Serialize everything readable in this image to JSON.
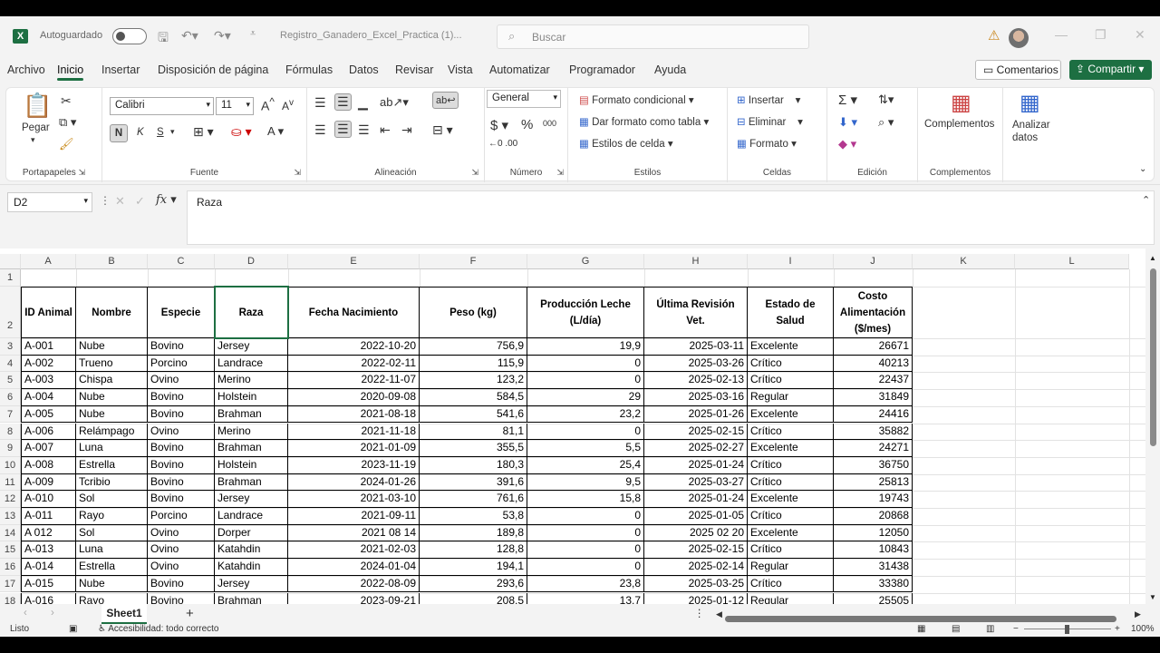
{
  "titlebar": {
    "autosave_label": "Autoguardado",
    "doc_title": "Registro_Ganadero_Excel_Practica (1)...",
    "search_placeholder": "Buscar"
  },
  "menu": {
    "tabs": [
      "Archivo",
      "Inicio",
      "Insertar",
      "Disposición de página",
      "Fórmulas",
      "Datos",
      "Revisar",
      "Vista",
      "Automatizar",
      "Programador",
      "Ayuda"
    ],
    "active": "Inicio",
    "comments_label": "Comentarios",
    "share_label": "Compartir"
  },
  "ribbon": {
    "portapapeles": {
      "label": "Portapapeles",
      "paste": "Pegar"
    },
    "fuente": {
      "label": "Fuente",
      "font_name": "Calibri",
      "font_size": "11",
      "bold": "N",
      "italic": "K",
      "underline": "S"
    },
    "alineacion": {
      "label": "Alineación"
    },
    "numero": {
      "label": "Número",
      "format": "General"
    },
    "estilos": {
      "label": "Estilos",
      "cond_format": "Formato condicional",
      "table_format": "Dar formato como tabla",
      "cell_styles": "Estilos de celda"
    },
    "celdas": {
      "label": "Celdas",
      "insert": "Insertar",
      "delete": "Eliminar",
      "format": "Formato"
    },
    "edicion": {
      "label": "Edición"
    },
    "complementos": {
      "label": "Complementos",
      "addins": "Complementos",
      "analyze": "Analizar datos"
    }
  },
  "formula_bar": {
    "name_box": "D2",
    "content": "Raza"
  },
  "columns": [
    "A",
    "B",
    "C",
    "D",
    "E",
    "F",
    "G",
    "H",
    "I",
    "J",
    "K",
    "L"
  ],
  "headers": [
    "ID Animal",
    "Nombre",
    "Especie",
    "Raza",
    "Fecha Nacimiento",
    "Peso (kg)",
    "Producción Leche (L/día)",
    "Última Revisión Vet.",
    "Estado de Salud",
    "Costo Alimentación ($/mes)"
  ],
  "rows": [
    [
      "A-001",
      "Nube",
      "Bovino",
      "Jersey",
      "2022-10-20",
      "756,9",
      "19,9",
      "2025-03-11",
      "Excelente",
      "26671"
    ],
    [
      "A-002",
      "Trueno",
      "Porcino",
      "Landrace",
      "2022-02-11",
      "115,9",
      "0",
      "2025-03-26",
      "Crítico",
      "40213"
    ],
    [
      "A-003",
      "Chispa",
      "Ovino",
      "Merino",
      "2022-11-07",
      "123,2",
      "0",
      "2025-02-13",
      "Crítico",
      "22437"
    ],
    [
      "A-004",
      "Nube",
      "Bovino",
      "Holstein",
      "2020-09-08",
      "584,5",
      "29",
      "2025-03-16",
      "Regular",
      "31849"
    ],
    [
      "A-005",
      "Nube",
      "Bovino",
      "Brahman",
      "2021-08-18",
      "541,6",
      "23,2",
      "2025-01-26",
      "Excelente",
      "24416"
    ],
    [
      "A-006",
      "Relámpago",
      "Ovino",
      "Merino",
      "2021-11-18",
      "81,1",
      "0",
      "2025-02-15",
      "Crítico",
      "35882"
    ],
    [
      "A-007",
      "Luna",
      "Bovino",
      "Brahman",
      "2021-01-09",
      "355,5",
      "5,5",
      "2025-02-27",
      "Excelente",
      "24271"
    ],
    [
      "A-008",
      "Estrella",
      "Bovino",
      "Holstein",
      "2023-11-19",
      "180,3",
      "25,4",
      "2025-01-24",
      "Crítico",
      "36750"
    ],
    [
      "A-009",
      "Tcribio",
      "Bovino",
      "Brahman",
      "2024-01-26",
      "391,6",
      "9,5",
      "2025-03-27",
      "Crítico",
      "25813"
    ],
    [
      "A-010",
      "Sol",
      "Bovino",
      "Jersey",
      "2021-03-10",
      "761,6",
      "15,8",
      "2025-01-24",
      "Excelente",
      "19743"
    ],
    [
      "A-011",
      "Rayo",
      "Porcino",
      "Landrace",
      "2021-09-11",
      "53,8",
      "0",
      "2025-01-05",
      "Crítico",
      "20868"
    ],
    [
      "A 012",
      "Sol",
      "Ovino",
      "Dorper",
      "2021 08 14",
      "189,8",
      "0",
      "2025 02 20",
      "Excelente",
      "12050"
    ],
    [
      "A-013",
      "Luna",
      "Ovino",
      "Katahdin",
      "2021-02-03",
      "128,8",
      "0",
      "2025-02-15",
      "Crítico",
      "10843"
    ],
    [
      "A-014",
      "Estrella",
      "Ovino",
      "Katahdin",
      "2024-01-04",
      "194,1",
      "0",
      "2025-02-14",
      "Regular",
      "31438"
    ],
    [
      "A-015",
      "Nube",
      "Bovino",
      "Jersey",
      "2022-08-09",
      "293,6",
      "23,8",
      "2025-03-25",
      "Crítico",
      "33380"
    ],
    [
      "A-016",
      "Rayo",
      "Bovino",
      "Brahman",
      "2023-09-21",
      "208,5",
      "13,7",
      "2025-01-12",
      "Regular",
      "25505"
    ]
  ],
  "sheet": {
    "tab": "Sheet1"
  },
  "status": {
    "ready": "Listo",
    "accessibility": "Accesibilidad: todo correcto",
    "zoom": "100%"
  }
}
